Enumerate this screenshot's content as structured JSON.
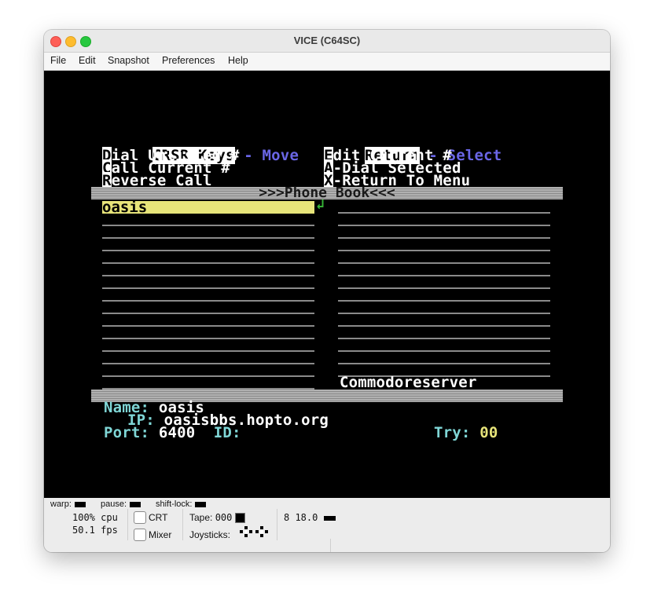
{
  "window": {
    "title": "VICE (C64SC)"
  },
  "menu": [
    "File",
    "Edit",
    "Snapshot",
    "Preferences",
    "Help"
  ],
  "c64": {
    "keys_label": "CRSR Keys",
    "move_label": " - Move",
    "return_label": "Return",
    "select_label": " - Select",
    "cmds": [
      {
        "key": "D",
        "text": "ial Unlisted #"
      },
      {
        "key": "C",
        "text": "all Current #"
      },
      {
        "key": "R",
        "text": "everse Call"
      },
      {
        "key": "E",
        "text": "dit Current #"
      },
      {
        "key": "A",
        "text": "-Dial Selected"
      },
      {
        "key": "X",
        "text": "-Return To Menu"
      }
    ],
    "phonebook_title": ">>>Phone Book<<<",
    "selected_entry": "oasis",
    "right_entry": "Commodoreserver",
    "name_label": "Name:",
    "name_value": "oasis",
    "ip_label": "IP:",
    "ip_value": "oasisbbs.hopto.org",
    "port_label": "Port:",
    "port_value": "6400",
    "id_label": "ID:",
    "try_label": "Try:",
    "try_value": "00",
    "colors": {
      "highlight": "#e7e47a",
      "labels": "#7fd6d6",
      "accent": "#6a66e6"
    }
  },
  "status": {
    "warp_label": "warp:",
    "pause_label": "pause:",
    "shiftlock_label": "shift-lock:",
    "cpu": "100% cpu",
    "fps": "50.1 fps",
    "crt_label": "CRT",
    "mixer_label": "Mixer",
    "tape_label": "Tape:",
    "tape_counter": "000",
    "joysticks_label": "Joysticks:",
    "drive": "8 18.0"
  }
}
